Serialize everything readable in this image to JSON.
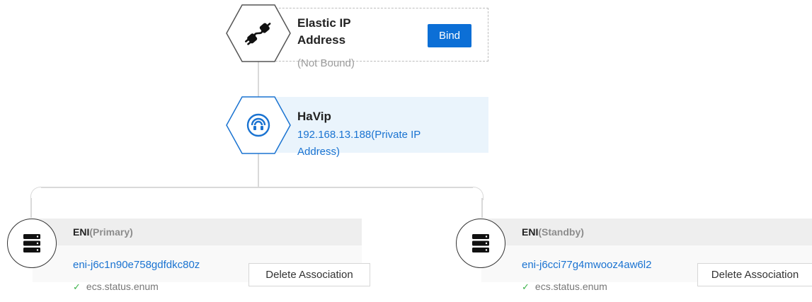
{
  "eip": {
    "title_line1": "Elastic IP",
    "title_line2": "Address",
    "status": "(Not Bound)",
    "bind_label": "Bind",
    "icon": "link-plug-icon"
  },
  "havip": {
    "title": "HaVip",
    "ip_line1": "192.168.13.188(Private IP",
    "ip_line2": "Address)",
    "icon": "wifi-headset-icon"
  },
  "enis": [
    {
      "label": "ENI",
      "role": "(Primary)",
      "id": "eni-j6c1n90e758gdfdkc80z",
      "status": "ecs.status.enum",
      "action": "Delete Association"
    },
    {
      "label": "ENI",
      "role": "(Standby)",
      "id": "eni-j6cci77g4mwooz4aw6l2",
      "status": "ecs.status.enum",
      "action": "Delete Association"
    }
  ],
  "colors": {
    "primary": "#0c6fd6",
    "link": "#1a73d1",
    "highlight": "#eaf4fc",
    "success": "#3cb34a"
  }
}
